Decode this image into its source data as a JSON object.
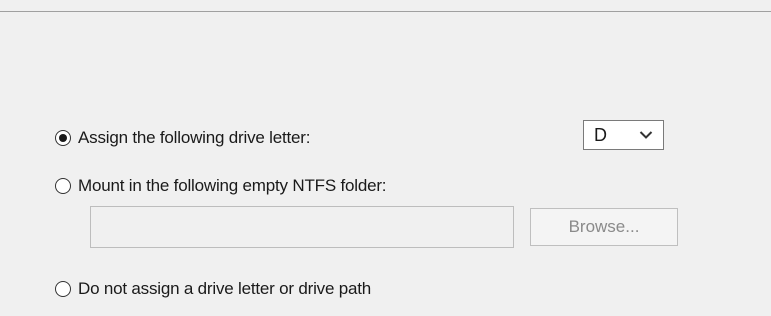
{
  "options": {
    "assign_letter": {
      "label": "Assign the following drive letter:",
      "selected": true
    },
    "mount_folder": {
      "label": "Mount in the following empty NTFS folder:",
      "selected": false
    },
    "no_assign": {
      "label": "Do not assign a drive letter or drive path",
      "selected": false
    }
  },
  "drive_letter": {
    "value": "D"
  },
  "mount_path": {
    "value": ""
  },
  "browse_button": {
    "label": "Browse...",
    "enabled": false
  }
}
